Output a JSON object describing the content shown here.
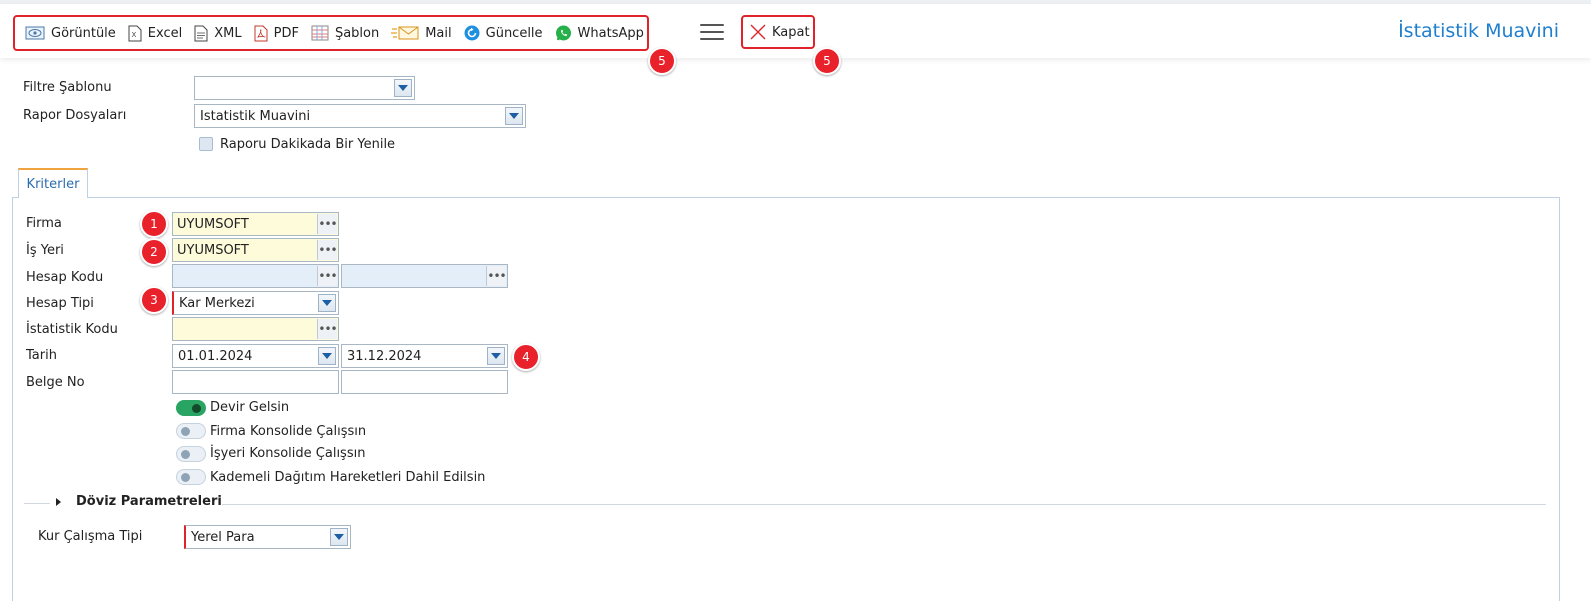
{
  "toolbar": {
    "buttons": [
      {
        "label": "Görüntüle",
        "icon": "preview-icon"
      },
      {
        "label": "Excel",
        "icon": "excel-icon"
      },
      {
        "label": "XML",
        "icon": "xml-icon"
      },
      {
        "label": "PDF",
        "icon": "pdf-icon"
      },
      {
        "label": "Şablon",
        "icon": "template-icon"
      },
      {
        "label": "Mail",
        "icon": "mail-icon"
      },
      {
        "label": "Güncelle",
        "icon": "refresh-icon"
      },
      {
        "label": "WhatsApp",
        "icon": "whatsapp-icon"
      }
    ],
    "close_label": "Kapat"
  },
  "app_title": "İstatistik Muavini",
  "badges": {
    "toolbar": "5",
    "close": "5",
    "firma": "1",
    "isyeri": "2",
    "hesap_tipi": "3",
    "tarih": "4"
  },
  "top_form": {
    "filter_template_label": "Filtre Şablonu",
    "filter_template_value": "",
    "report_files_label": "Rapor Dosyaları",
    "report_files_value": "İstatistik Muavini",
    "refresh_minute_label": "Raporu Dakikada Bir Yenile"
  },
  "tab": {
    "label": "Kriterler"
  },
  "criteria": {
    "firma_label": "Firma",
    "firma_value": "UYUMSOFT",
    "isyeri_label": "İş Yeri",
    "isyeri_value": "UYUMSOFT",
    "hesap_kodu_label": "Hesap Kodu",
    "hesap_kodu_from": "",
    "hesap_kodu_to": "",
    "hesap_tipi_label": "Hesap Tipi",
    "hesap_tipi_value": "Kar Merkezi",
    "istatistik_kodu_label": "İstatistik Kodu",
    "istatistik_kodu_value": "",
    "tarih_label": "Tarih",
    "tarih_from": "01.01.2024",
    "tarih_to": "31.12.2024",
    "belge_no_label": "Belge No",
    "belge_no_from": "",
    "belge_no_to": ""
  },
  "toggles": [
    {
      "label": "Devir Gelsin",
      "on": true
    },
    {
      "label": "Firma Konsolide Çalışsın",
      "on": false
    },
    {
      "label": "İşyeri Konsolide Çalışsın",
      "on": false
    },
    {
      "label": "Kademeli Dağıtım Hareketleri Dahil Edilsin",
      "on": false
    }
  ],
  "doviz": {
    "section_title": "Döviz Parametreleri",
    "kur_label": "Kur Çalışma Tipi",
    "kur_value": "Yerel Para"
  },
  "colors": {
    "accent_red": "#e0222a",
    "title_blue": "#1f7fcf",
    "toggle_on": "#2aa463"
  }
}
